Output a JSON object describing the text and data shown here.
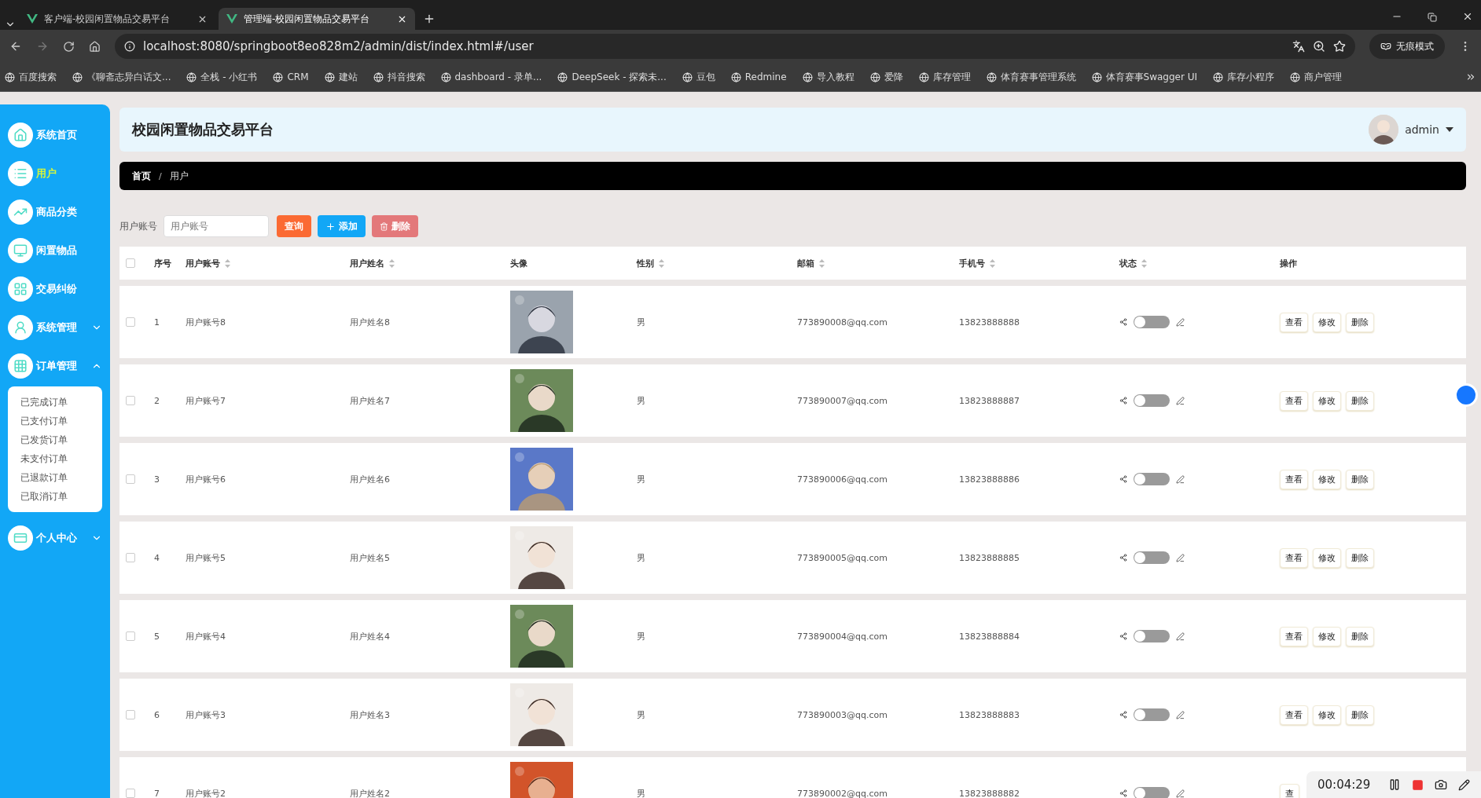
{
  "browser": {
    "tabs": [
      {
        "title": "客户端-校园闲置物品交易平台",
        "selected": false
      },
      {
        "title": "管理端-校园闲置物品交易平台",
        "selected": true
      }
    ],
    "url": "localhost:8080/springboot8eo828m2/admin/dist/index.html#/user",
    "incognito_label": "无痕模式",
    "bookmarks": [
      "百度搜索",
      "《聊斋志异白话文...",
      "全栈 - 小红书",
      "CRM",
      "建站",
      "抖音搜索",
      "dashboard - 录单...",
      "DeepSeek - 探索未...",
      "豆包",
      "Redmine",
      "导入教程",
      "爱降",
      "库存管理",
      "体育赛事管理系统",
      "体育赛事Swagger UI",
      "库存小程序",
      "商户管理"
    ]
  },
  "sidebar": {
    "items": [
      {
        "kind": "home",
        "label": "系统首页",
        "selected": false
      },
      {
        "kind": "list",
        "label": "用户",
        "selected": true
      },
      {
        "kind": "chart",
        "label": "商品分类",
        "selected": false
      },
      {
        "kind": "monitor",
        "label": "闲置物品",
        "selected": false
      },
      {
        "kind": "grid4",
        "label": "交易纠纷",
        "selected": false
      },
      {
        "kind": "user",
        "label": "系统管理",
        "selected": false,
        "expanded": false
      },
      {
        "kind": "grid9",
        "label": "订单管理",
        "selected": false,
        "expanded": true,
        "children": [
          {
            "label": "已完成订单"
          },
          {
            "label": "已支付订单"
          },
          {
            "label": "已发货订单"
          },
          {
            "label": "未支付订单"
          },
          {
            "label": "已退款订单"
          },
          {
            "label": "已取消订单"
          }
        ]
      },
      {
        "kind": "card",
        "label": "个人中心",
        "selected": false,
        "expanded": false
      }
    ]
  },
  "header": {
    "title": "校园闲置物品交易平台",
    "user": "admin"
  },
  "breadcrumb": {
    "items": [
      "首页",
      "用户"
    ],
    "separator": "/"
  },
  "search": {
    "label": "用户账号",
    "placeholder": "用户账号"
  },
  "buttons": [
    {
      "kind": "search",
      "label": "查询"
    },
    {
      "kind": "add",
      "label": "添加"
    },
    {
      "kind": "delete",
      "label": "删除"
    }
  ],
  "table": {
    "all_checked": false,
    "columns": [
      {
        "label": "序号",
        "sortable": false
      },
      {
        "label": "用户账号",
        "sortable": true
      },
      {
        "label": "用户姓名",
        "sortable": true
      },
      {
        "label": "头像",
        "sortable": false
      },
      {
        "label": "性别",
        "sortable": true
      },
      {
        "label": "邮箱",
        "sortable": true
      },
      {
        "label": "手机号",
        "sortable": true
      },
      {
        "label": "状态",
        "sortable": true
      },
      {
        "label": "操作",
        "sortable": false
      }
    ],
    "rows": [
      {
        "index": "1",
        "account": "用户账号8",
        "name": "用户姓名8",
        "avatar": {
          "kind": "picture"
        },
        "gender": "男",
        "email": "773890008@qq.com",
        "phone": "13823888888",
        "checked": false,
        "on": false,
        "actions": [
          "查看",
          "修改",
          "删除"
        ]
      },
      {
        "index": "2",
        "account": "用户账号7",
        "name": "用户姓名7",
        "avatar": {
          "kind": "picture"
        },
        "gender": "男",
        "email": "773890007@qq.com",
        "phone": "13823888887",
        "checked": false,
        "on": false,
        "actions": [
          "查看",
          "修改",
          "删除"
        ]
      },
      {
        "index": "3",
        "account": "用户账号6",
        "name": "用户姓名6",
        "avatar": {
          "kind": "picture"
        },
        "gender": "男",
        "email": "773890006@qq.com",
        "phone": "13823888886",
        "checked": false,
        "on": false,
        "actions": [
          "查看",
          "修改",
          "删除"
        ]
      },
      {
        "index": "4",
        "account": "用户账号5",
        "name": "用户姓名5",
        "avatar": {
          "kind": "picture"
        },
        "gender": "男",
        "email": "773890005@qq.com",
        "phone": "13823888885",
        "checked": false,
        "on": false,
        "actions": [
          "查看",
          "修改",
          "删除"
        ]
      },
      {
        "index": "5",
        "account": "用户账号4",
        "name": "用户姓名4",
        "avatar": {
          "kind": "picture"
        },
        "gender": "男",
        "email": "773890004@qq.com",
        "phone": "13823888884",
        "checked": false,
        "on": false,
        "actions": [
          "查看",
          "修改",
          "删除"
        ]
      },
      {
        "index": "6",
        "account": "用户账号3",
        "name": "用户姓名3",
        "avatar": {
          "kind": "picture"
        },
        "gender": "男",
        "email": "773890003@qq.com",
        "phone": "13823888883",
        "checked": false,
        "on": false,
        "actions": [
          "查看",
          "修改",
          "删除"
        ]
      },
      {
        "index": "7",
        "account": "用户账号2",
        "name": "用户姓名2",
        "avatar": {
          "kind": "picture"
        },
        "gender": "男",
        "email": "773890002@qq.com",
        "phone": "13823888882",
        "checked": false,
        "on": false,
        "actions": [
          "查"
        ]
      }
    ]
  },
  "recorder": {
    "time": "00:04:29"
  }
}
